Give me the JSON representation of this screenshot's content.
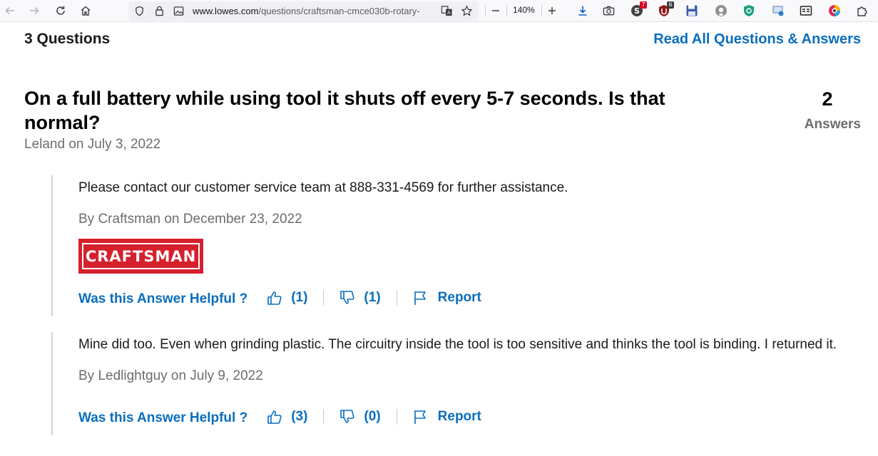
{
  "browser": {
    "url_host": "www.lowes.com",
    "url_path": "/questions/craftsman-cmce030b-rotary-",
    "zoom": "140%",
    "extensions": [
      {
        "name": "extension-1",
        "badge": "7",
        "badge_color": "#d70022"
      },
      {
        "name": "extension-2",
        "badge": "6",
        "badge_color": "#3a3a3a"
      }
    ]
  },
  "summary": {
    "questions_count": "3 Questions",
    "read_all_link": "Read All Questions & Answers"
  },
  "question": {
    "title": "On a full battery while using tool it shuts off every 5-7 seconds. Is that normal?",
    "meta": "Leland on July 3, 2022",
    "answers_count": "2",
    "answers_label": "Answers"
  },
  "answers": [
    {
      "text": "Please contact our customer service team at 888-331-4569 for further assistance.",
      "byline": "By Craftsman on December 23, 2022",
      "brand_logo": "CRAFTSMAN",
      "helpful_prompt": "Was this Answer Helpful ?",
      "upvotes": "(1)",
      "downvotes": "(1)",
      "report": "Report"
    },
    {
      "text": "Mine did too. Even when grinding plastic. The circuitry inside the tool is too sensitive and thinks the tool is binding. I returned it.",
      "byline": "By Ledlightguy on July 9, 2022",
      "helpful_prompt": "Was this Answer Helpful ?",
      "upvotes": "(3)",
      "downvotes": "(0)",
      "report": "Report"
    }
  ],
  "colors": {
    "link_blue": "#0a6ebd",
    "brand_red": "#d6202d",
    "muted_text": "#6d6d6d"
  }
}
